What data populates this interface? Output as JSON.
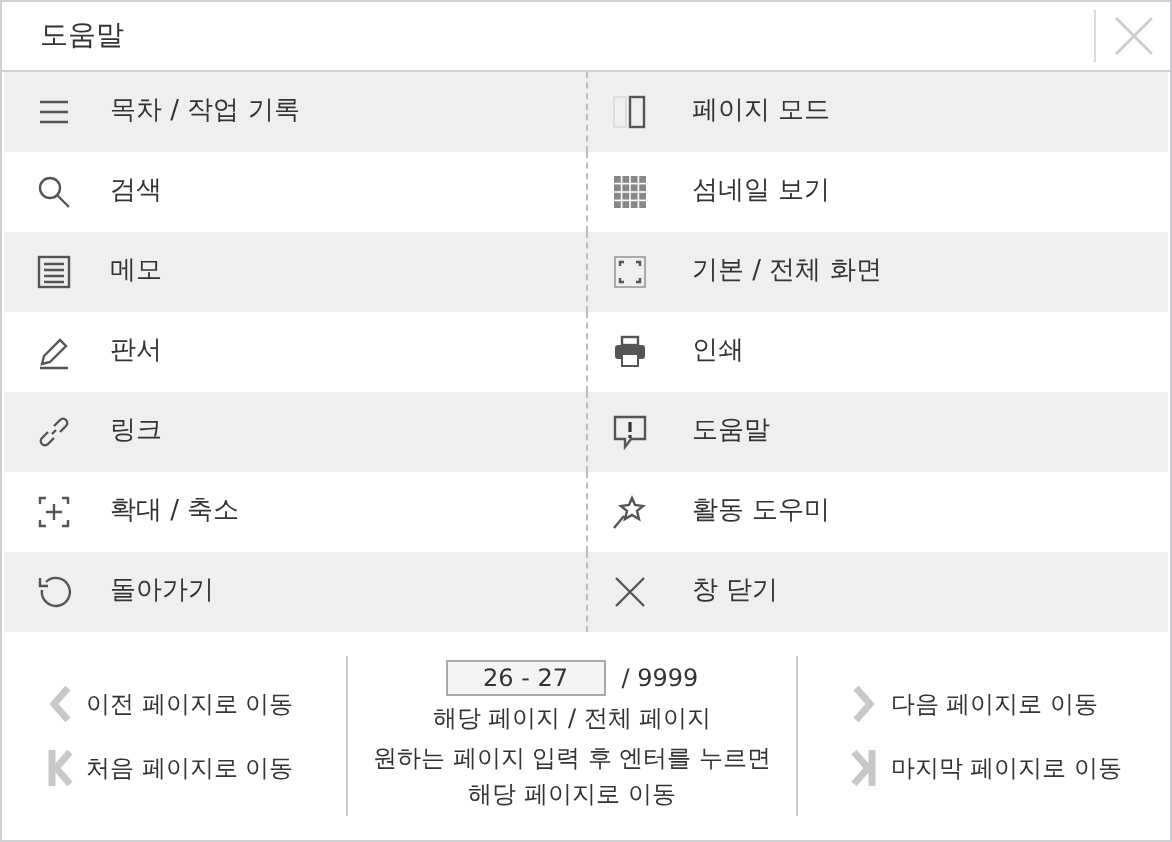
{
  "window": {
    "title": "도움말"
  },
  "menu": [
    {
      "label": "목차 / 작업 기록"
    },
    {
      "label": "페이지 모드"
    },
    {
      "label": "검색"
    },
    {
      "label": "섬네일 보기"
    },
    {
      "label": "메모"
    },
    {
      "label": "기본 / 전체 화면"
    },
    {
      "label": "판서"
    },
    {
      "label": "인쇄"
    },
    {
      "label": "링크"
    },
    {
      "label": "도움말"
    },
    {
      "label": "확대 / 축소"
    },
    {
      "label": "활동 도우미"
    },
    {
      "label": "돌아가기"
    },
    {
      "label": "창 닫기"
    }
  ],
  "footer": {
    "prev": "이전 페이지로 이동",
    "first": "처음 페이지로 이동",
    "page_value": "26 - 27",
    "total": "/ 9999",
    "page_caption": "해당 페이지 / 전체 페이지",
    "hint": "원하는 페이지 입력 후 엔터를 누르면 해당 페이지로 이동",
    "next": "다음 페이지로 이동",
    "last": "마지막 페이지로 이동"
  }
}
